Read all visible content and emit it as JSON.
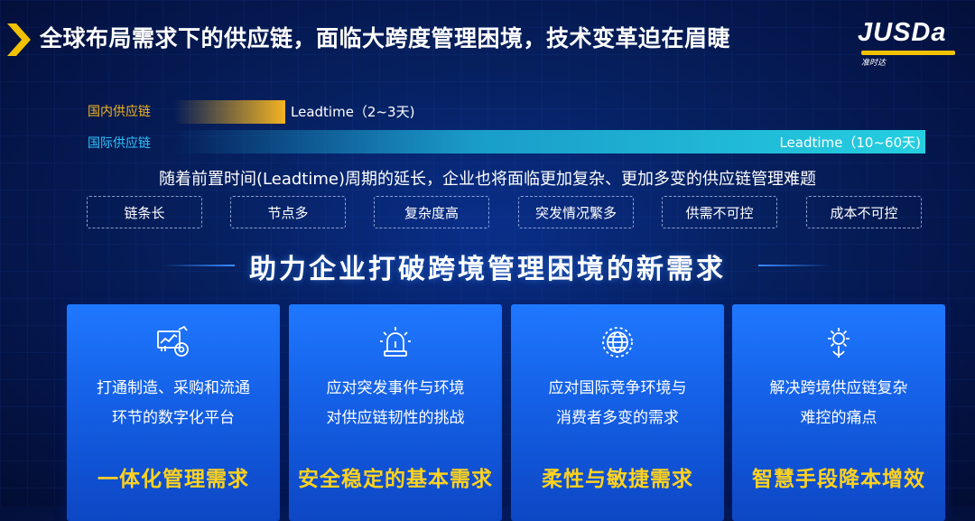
{
  "header": {
    "title": "全球布局需求下的供应链，面临大跨度管理困境，技术变革迫在眉睫",
    "logo_text": "JUSDa",
    "logo_sub": "准时达",
    "accent_color": "#f2c200"
  },
  "leadtime": {
    "domestic": {
      "label": "国内供应链",
      "text": "Leadtime（2~3天)",
      "color": "#f5b51f"
    },
    "international": {
      "label": "国际供应链",
      "text": "Leadtime（10~60天)",
      "color": "#25cfe1"
    }
  },
  "subtitle": "随着前置时间(Leadtime)周期的延长，企业也将面临更加复杂、更加多变的供应链管理难题",
  "challenges": [
    "链条长",
    "节点多",
    "复杂度高",
    "突发情况繁多",
    "供需不可控",
    "成本不可控"
  ],
  "section_title": "助力企业打破跨境管理困境的新需求",
  "cards": [
    {
      "icon": "digital-dashboard-icon",
      "desc_line1": "打通制造、采购和流通",
      "desc_line2": "环节的数字化平台",
      "title": "一体化管理需求"
    },
    {
      "icon": "alarm-light-icon",
      "desc_line1": "应对突发事件与环境",
      "desc_line2": "对供应链韧性的挑战",
      "title": "安全稳定的基本需求"
    },
    {
      "icon": "globe-icon",
      "desc_line1": "应对国际竞争环境与",
      "desc_line2": "消费者多变的需求",
      "title": "柔性与敏捷需求"
    },
    {
      "icon": "gear-brain-icon",
      "desc_line1": "解决跨境供应链复杂",
      "desc_line2": "难控的痛点",
      "title": "智慧手段降本增效"
    }
  ]
}
